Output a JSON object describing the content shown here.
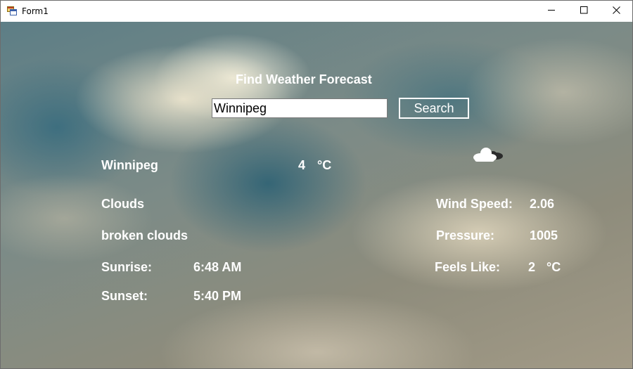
{
  "window": {
    "title": "Form1",
    "icon": "winforms-app-icon",
    "controls": [
      "minimize-icon",
      "maximize-icon",
      "close-icon"
    ]
  },
  "heading": "Find Weather Forecast",
  "search": {
    "value": "Winnipeg",
    "button_label": "Search"
  },
  "weather": {
    "city": "Winnipeg",
    "temperature": "4",
    "temp_unit": "°C",
    "icon": "cloud-icon",
    "condition": "Clouds",
    "description": "broken clouds",
    "sunrise_label": "Sunrise:",
    "sunrise": "6:48 AM",
    "sunset_label": "Sunset:",
    "sunset": "5:40 PM",
    "wind_label": "Wind Speed:",
    "wind": "2.06",
    "pressure_label": "Pressure:",
    "pressure": "1005",
    "feels_label": "Feels Like:",
    "feels": "2",
    "feels_unit": "°C"
  },
  "colors": {
    "text": "#ffffff",
    "titlebar": "#ffffff"
  }
}
